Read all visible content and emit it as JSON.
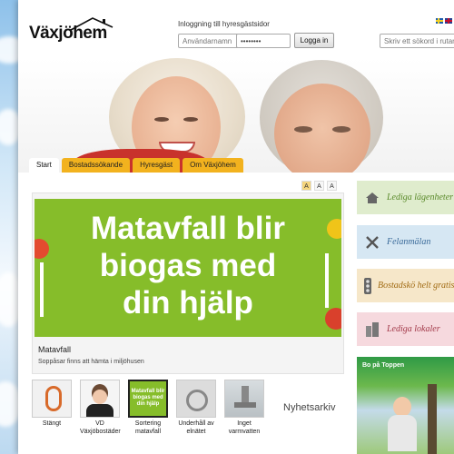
{
  "header": {
    "logo_text": "Växjöhem",
    "login_title": "Inloggning till hyresgästsidor",
    "username_placeholder": "Användarnamn",
    "password_value": "••••••••",
    "login_button": "Logga in",
    "search_placeholder": "Skriv ett sökord i rutan..."
  },
  "tabs": [
    {
      "label": "Start"
    },
    {
      "label": "Bostadssökande"
    },
    {
      "label": "Hyresgäst"
    },
    {
      "label": "Om Växjöhem"
    }
  ],
  "font_controls": [
    "A",
    "A",
    "A"
  ],
  "featured": {
    "banner_lines": [
      "Matavfall blir",
      "biogas med",
      "din hjälp"
    ],
    "title": "Matavfall",
    "subtitle": "Soppåsar finns att hämta i miljöhusen"
  },
  "thumbnails": [
    {
      "caption": "Stängt"
    },
    {
      "caption": "VD Växjöbostäder"
    },
    {
      "caption": "Sortering matavfall",
      "image_text": [
        "Matavfall blir",
        "biogas med",
        "din hjälp"
      ]
    },
    {
      "caption": "Underhåll av elnätet"
    },
    {
      "caption": "Inget varmvatten"
    }
  ],
  "news_link": "Nyhetsarkiv",
  "sidebar": [
    {
      "label": "Lediga lägenheter",
      "icon": "house-icon",
      "bg": "#dfeccd",
      "color": "#5a8a2a"
    },
    {
      "label": "Felanmälan",
      "icon": "tools-icon",
      "bg": "#d6e7f3",
      "color": "#3b6b9a"
    },
    {
      "label": "Bostadskö helt gratis",
      "icon": "traffic-light-icon",
      "bg": "#f6e7c9",
      "color": "#a06a12"
    },
    {
      "label": "Lediga lokaler",
      "icon": "buildings-icon",
      "bg": "#f6d9de",
      "color": "#a33a4a"
    }
  ],
  "promo": {
    "title": "Bo på Toppen"
  },
  "colors": {
    "tab_yellow": "#f2b21e",
    "banner_green": "#86bd2a"
  }
}
